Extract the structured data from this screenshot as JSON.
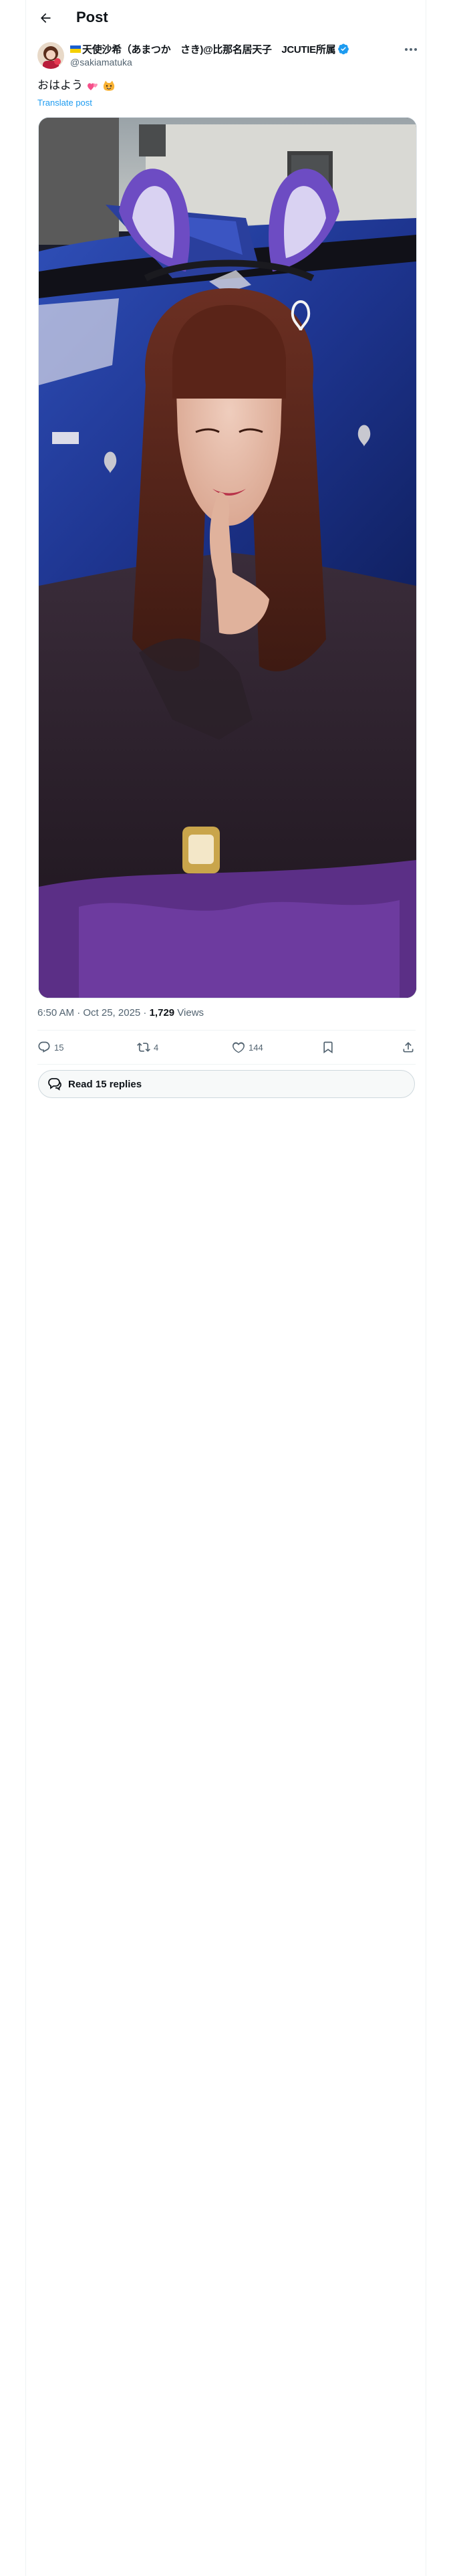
{
  "header": {
    "title": "Post",
    "back_icon": "arrow-left-icon"
  },
  "author": {
    "flag_icon": "ukraine-flag-icon",
    "display_name": "天使沙希（あまつか　さき)@比那名居天子　JCUTIE所属",
    "handle": "@sakiamatuka",
    "verified": true,
    "verified_color": "#1d9bf0"
  },
  "post": {
    "text": "おはよう",
    "emojis": [
      "two-hearts-emoji",
      "cat-smile-emoji"
    ],
    "translate_label": "Translate post",
    "timestamp": "6:50 AM · Oct 25, 2025 · ",
    "views_count": "1,729",
    "views_label": " Views"
  },
  "actions": {
    "replies": "15",
    "reposts": "4",
    "likes": "144"
  },
  "read_replies_label": "Read 15 replies",
  "colors": {
    "accent": "#1d9bf0",
    "text": "#0f1419",
    "secondary": "#536471",
    "heart": "#f91880"
  }
}
